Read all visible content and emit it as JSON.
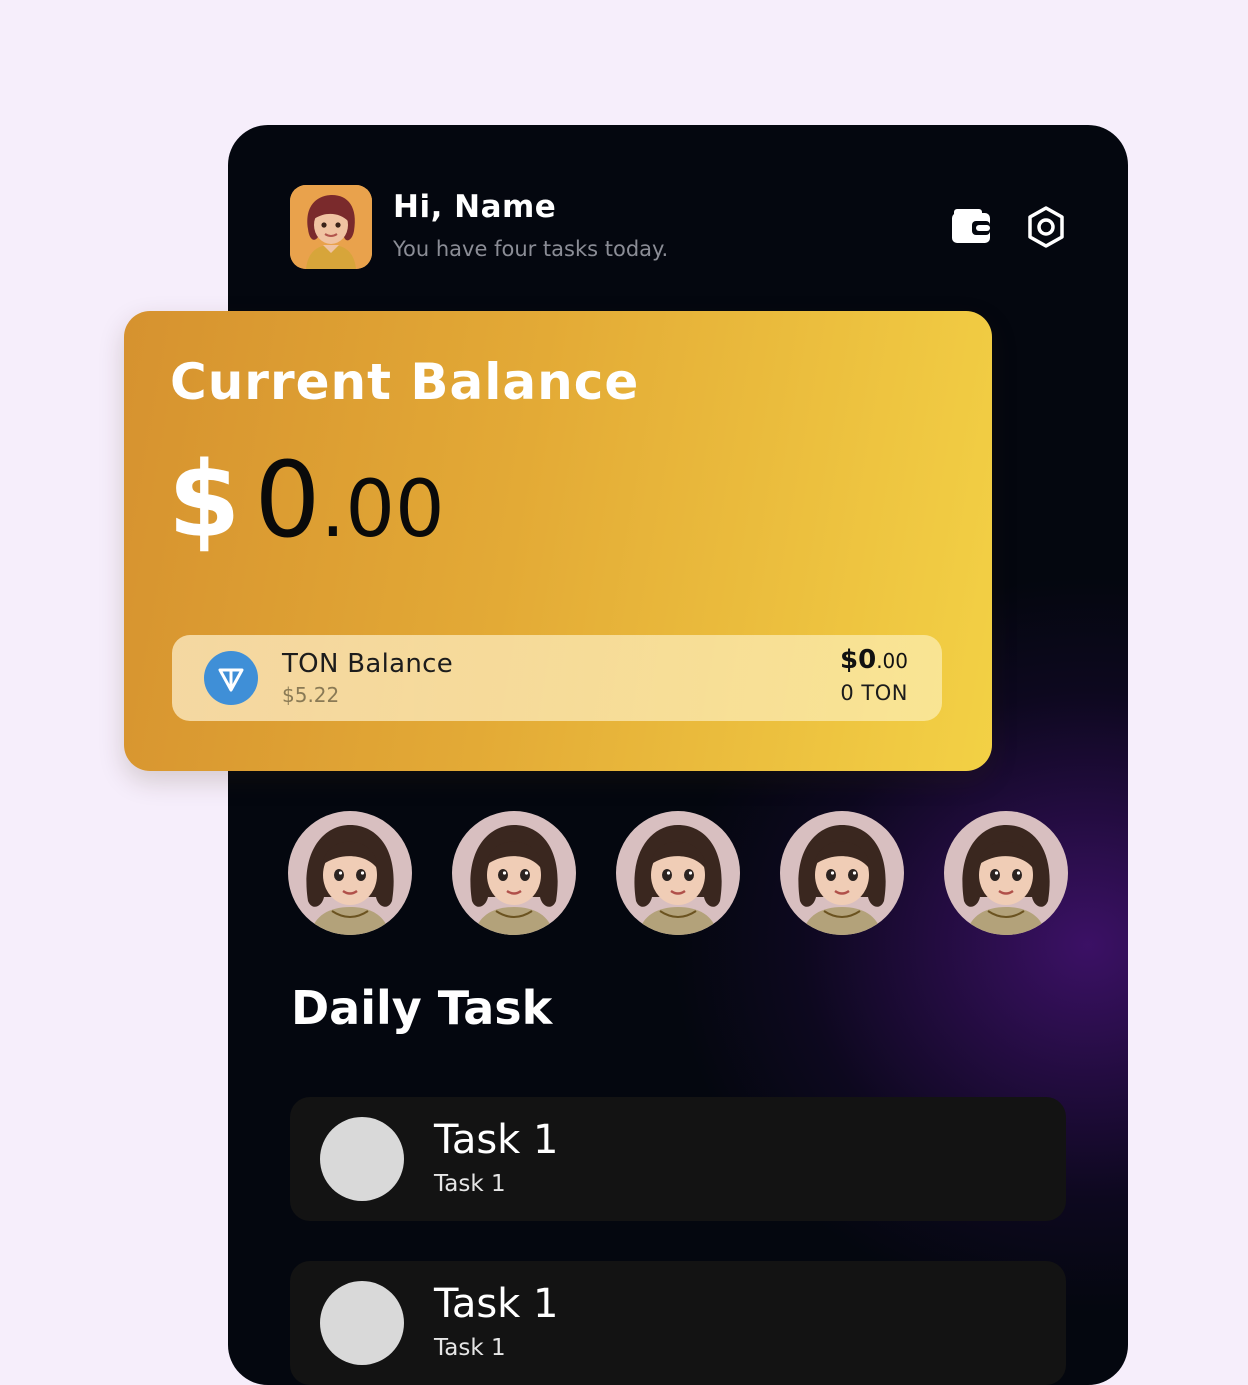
{
  "header": {
    "greeting": "Hi, Name",
    "subtitle": "You have four tasks today."
  },
  "balance_card": {
    "title": "Current Balance",
    "currency_symbol": "$",
    "amount_integer": "0",
    "amount_decimal": ".00"
  },
  "ton": {
    "label": "TON Balance",
    "usd_rate": "$5.22",
    "amount_symbol": "$",
    "amount_integer": "0",
    "amount_decimal": ".00",
    "ton_amount": "0 TON"
  },
  "friends": [
    {
      "icon": "girl-avatar"
    },
    {
      "icon": "girl-avatar"
    },
    {
      "icon": "girl-avatar"
    },
    {
      "icon": "girl-avatar"
    },
    {
      "icon": "girl-avatar"
    }
  ],
  "daily_task": {
    "title": "Daily Task",
    "tasks": [
      {
        "title": "Task 1",
        "subtitle": "Task 1"
      },
      {
        "title": "Task 1",
        "subtitle": "Task 1"
      }
    ]
  },
  "colors": {
    "page_bg": "#f6eefb",
    "phone_bg": "#04070f",
    "card_gradient_start": "#d6922f",
    "card_gradient_end": "#f3d145",
    "ton_blue": "#3f8fd7",
    "task_bg": "#131313"
  }
}
